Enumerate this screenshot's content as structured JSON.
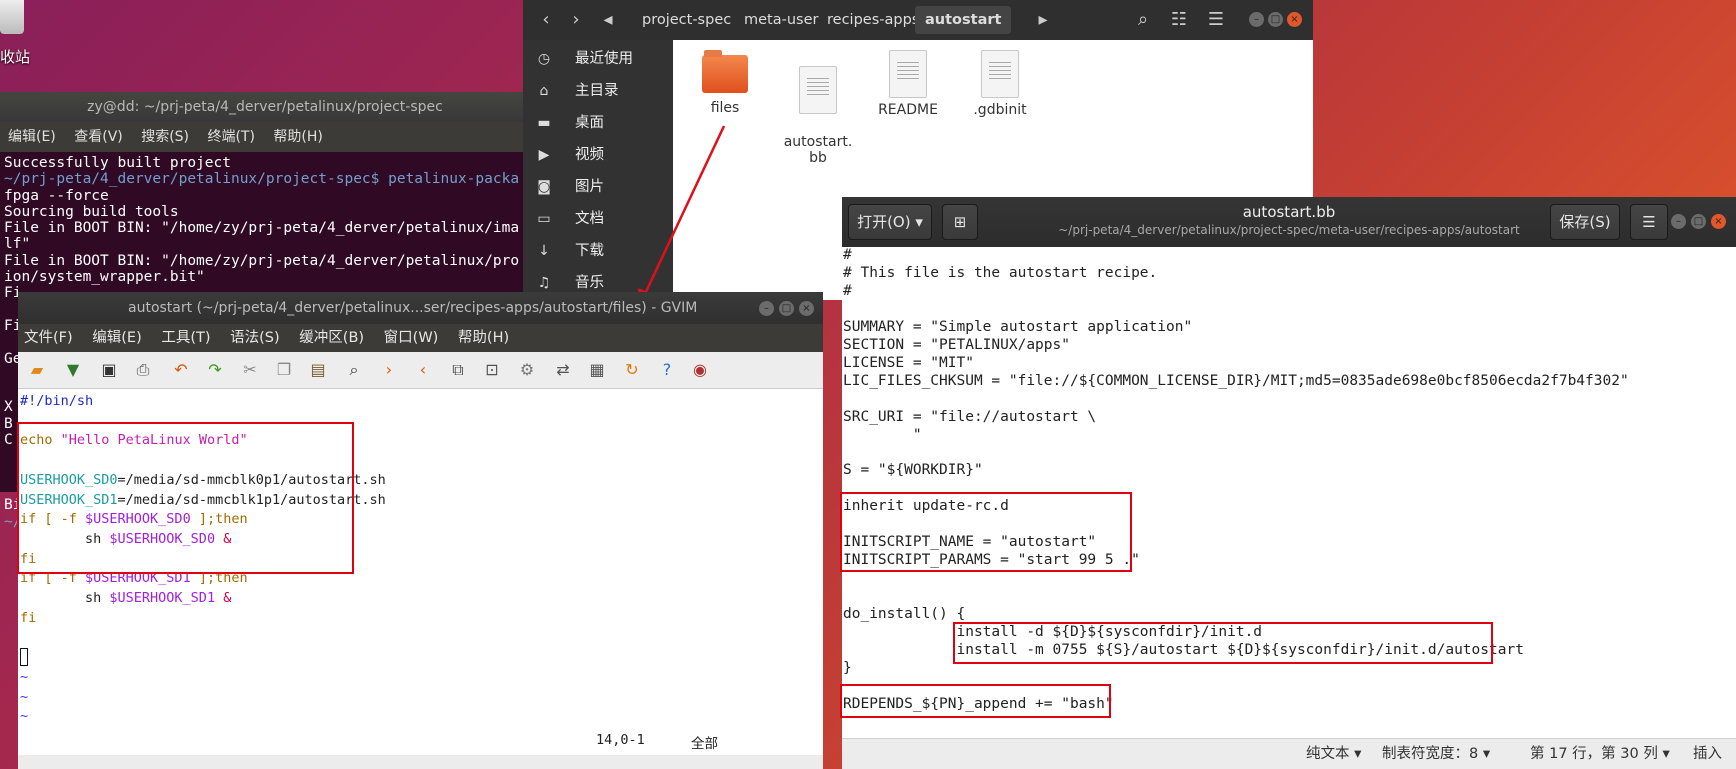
{
  "desktop": {
    "trash_label": "收站"
  },
  "terminal": {
    "title": "zy@dd: ~/prj-peta/4_derver/petalinux/project-spec",
    "menu": [
      "编辑(E)",
      "查看(V)",
      "搜索(S)",
      "终端(T)",
      "帮助(H)"
    ],
    "lines": [
      "Successfully built project",
      "~/prj-peta/4_derver/petalinux/project-spec$ petalinux-packa",
      "fpga --force",
      "Sourcing build tools",
      "File in BOOT BIN: \"/home/zy/prj-peta/4_derver/petalinux/ima",
      "lf\"",
      "File in BOOT BIN: \"/home/zy/prj-peta/4_derver/petalinux/pro",
      "ion/system_wrapper.bit\"",
      "Fi",
      "",
      "Fi",
      "",
      "Ge",
      "",
      "",
      "X",
      "B",
      "C",
      "",
      "",
      "",
      "Bi",
      "~/"
    ]
  },
  "file_manager": {
    "breadcrumbs": [
      "project-spec",
      "meta-user",
      "recipes-apps",
      "autostart"
    ],
    "sidebar": [
      "最近使用",
      "主目录",
      "桌面",
      "视频",
      "图片",
      "文档",
      "下载",
      "音乐"
    ],
    "files": [
      {
        "name": "files",
        "type": "folder"
      },
      {
        "name": "autostart.\nbb",
        "type": "file"
      },
      {
        "name": "README",
        "type": "file"
      },
      {
        "name": ".gdbinit",
        "type": "file"
      }
    ]
  },
  "editor": {
    "title": "autostart.bb",
    "path": "~/prj-peta/4_derver/petalinux/project-spec/meta-user/recipes-apps/autostart",
    "open_label": "打开(O)",
    "save_label": "保存(S)",
    "lines": [
      "#",
      "# This file is the autostart recipe.",
      "#",
      "",
      "SUMMARY = \"Simple autostart application\"",
      "SECTION = \"PETALINUX/apps\"",
      "LICENSE = \"MIT\"",
      "LIC_FILES_CHKSUM = \"file://${COMMON_LICENSE_DIR}/MIT;md5=0835ade698e0bcf8506ecda2f7b4f302\"",
      "",
      "SRC_URI = \"file://autostart \\",
      "        \"",
      "",
      "S = \"${WORKDIR}\"",
      "",
      "inherit update-rc.d",
      "",
      "INITSCRIPT_NAME = \"autostart\"",
      "INITSCRIPT_PARAMS = \"start 99 5 .\"",
      "",
      "",
      "do_install() {",
      "             install -d ${D}${sysconfdir}/init.d",
      "             install -m 0755 ${S}/autostart ${D}${sysconfdir}/init.d/autostart",
      "}",
      "",
      "RDEPENDS_${PN}_append += \"bash\""
    ],
    "status": {
      "syntax": "纯文本",
      "tab_width": "制表符宽度：8",
      "position": "第 17 行，第 30 列",
      "mode": "插入"
    }
  },
  "gvim": {
    "title": "autostart (~/prj-peta/4_derver/petalinux...ser/recipes-apps/autostart/files) - GVIM",
    "menu": [
      "文件(F)",
      "编辑(E)",
      "工具(T)",
      "语法(S)",
      "缓冲区(B)",
      "窗口(W)",
      "帮助(H)"
    ],
    "code": {
      "shebang": "#!/bin/sh",
      "echo_kw": "echo",
      "echo_str": "\"Hello PetaLinux World\"",
      "sd0_var": "USERHOOK_SD0",
      "sd0_val": "=/media/sd-mmcblk0p1/autostart.sh",
      "sd1_var": "USERHOOK_SD1",
      "sd1_val": "=/media/sd-mmcblk1p1/autostart.sh",
      "if_open": "if [ -f ",
      "if_close": " ];then",
      "ref_sd0": "$USERHOOK_SD0",
      "ref_sd1": "$USERHOOK_SD1",
      "sh": "        sh ",
      "amp": " &",
      "fi": "fi",
      "tilde": "~"
    },
    "status_pos": "14,0-1",
    "status_all": "全部"
  }
}
